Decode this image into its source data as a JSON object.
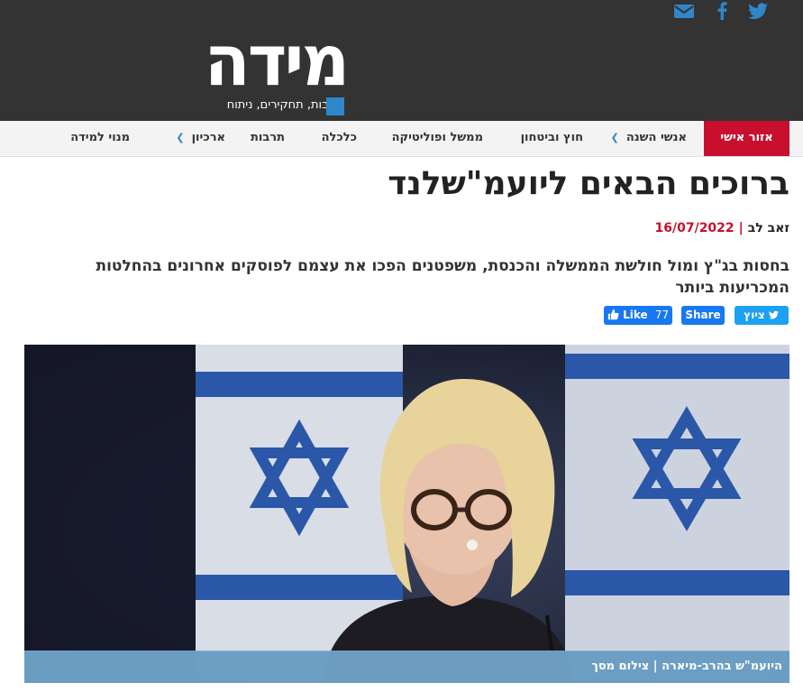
{
  "site": {
    "logo_text": "מידה",
    "tagline": "כתבות, תחקירים, ניתוח",
    "brand_colors": {
      "header": "#333333",
      "accent_red": "#c8102e",
      "accent_blue": "#2f86c9"
    }
  },
  "social_icons": [
    "twitter-icon",
    "facebook-icon",
    "email-icon"
  ],
  "nav": {
    "items": [
      {
        "label": "אזור אישי",
        "active": true
      },
      {
        "label": "אנשי השנה",
        "has_dropdown": true
      },
      {
        "label": "חוץ וביטחון"
      },
      {
        "label": "ממשל ופוליטיקה"
      },
      {
        "label": "כלכלה"
      },
      {
        "label": "תרבות"
      },
      {
        "label": "ארכיון",
        "has_dropdown": true
      },
      {
        "label": "מנוי למידה"
      }
    ]
  },
  "article": {
    "headline": "ברוכים הבאים ליועמ\"שלנד",
    "author": "זאב לב",
    "separator": "|",
    "date": "16/07/2022",
    "summary": "בחסות בג\"ץ ומול חולשת הממשלה והכנסת, משפטנים הפכו את עצמם לפוסקים אחרונים בהחלטות המכריעות ביותר",
    "share": {
      "like_label": "Like",
      "like_count": "77",
      "share_label": "Share",
      "tweet_label": "ציוץ"
    },
    "image_caption": "היועמ\"ש בהרב-מיארה | צילום מסך"
  }
}
